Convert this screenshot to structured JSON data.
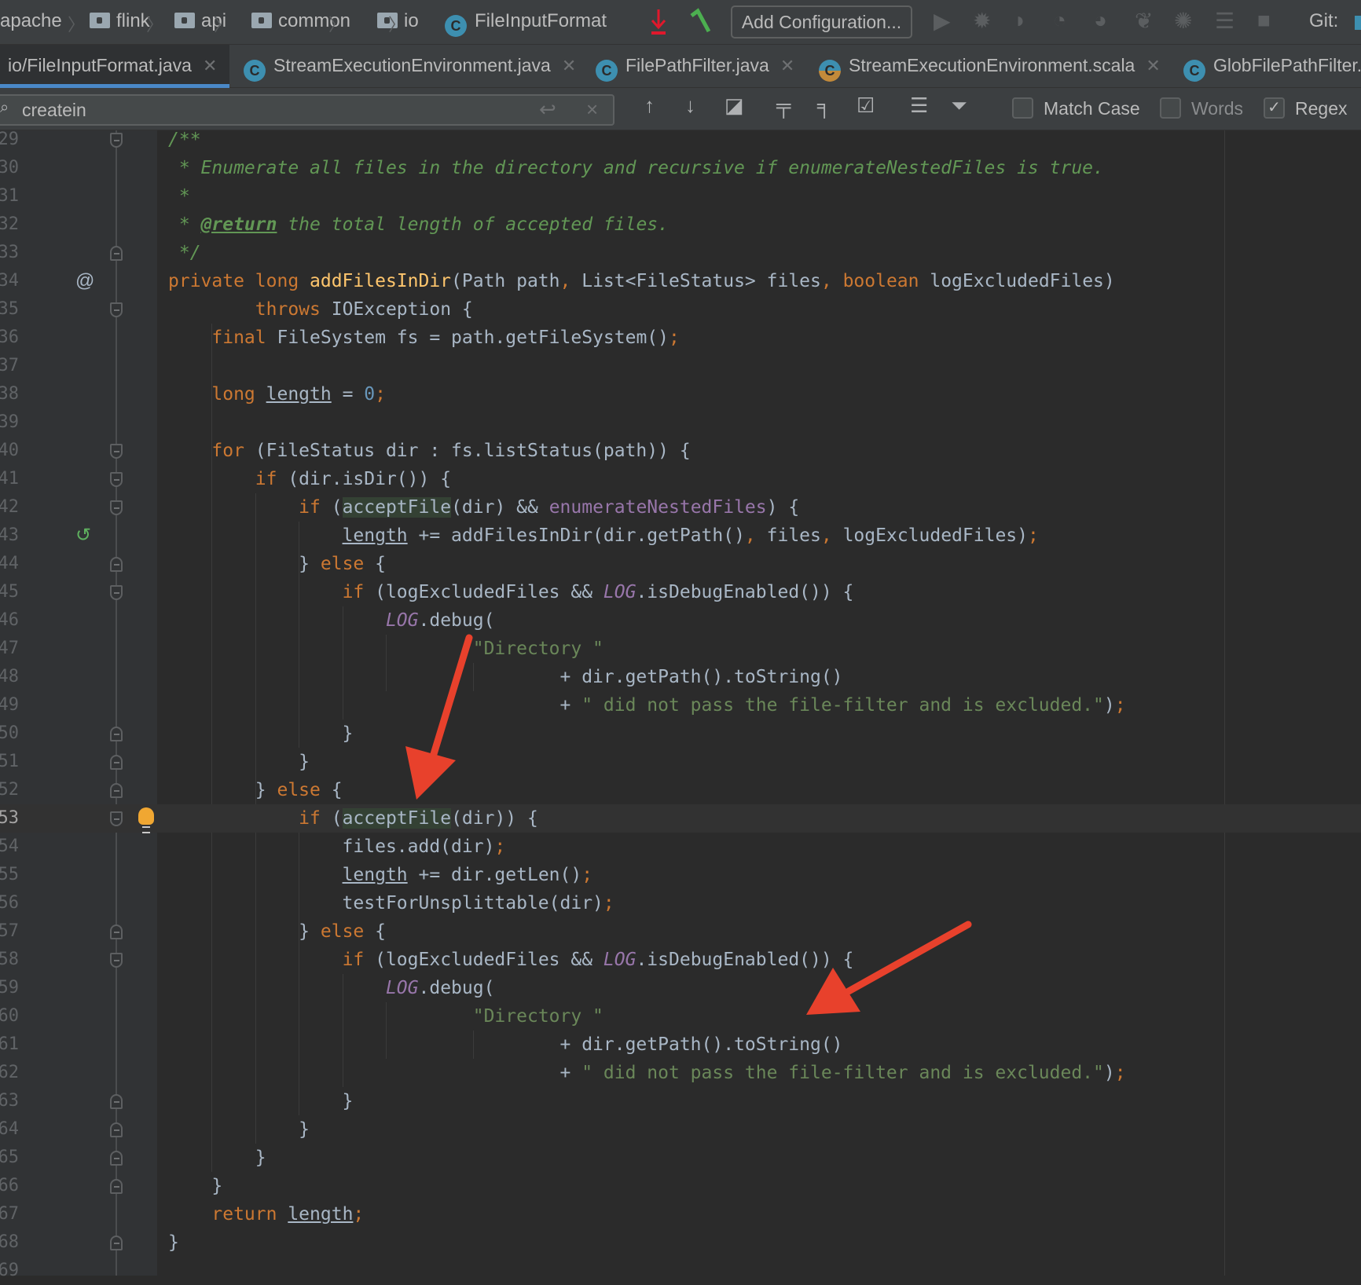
{
  "breadcrumbs": [
    {
      "label": "apache",
      "icon": "folder-icon"
    },
    {
      "label": "flink",
      "icon": "folder-icon"
    },
    {
      "label": "api",
      "icon": "folder-icon"
    },
    {
      "label": "common",
      "icon": "folder-icon"
    },
    {
      "label": "io",
      "icon": "folder-icon"
    },
    {
      "label": "FileInputFormat",
      "icon": "class-icon"
    }
  ],
  "toolbar": {
    "add_configuration": "Add Configuration...",
    "git_label": "Git:",
    "class_glyph": "C"
  },
  "tabs": [
    {
      "label": "io/FileInputFormat.java",
      "active": true
    },
    {
      "label": "StreamExecutionEnvironment.java"
    },
    {
      "label": "FilePathFilter.java"
    },
    {
      "label": "StreamExecutionEnvironment.scala"
    },
    {
      "label": "GlobFilePathFilter.java"
    }
  ],
  "find": {
    "query": "createin",
    "match_case": {
      "label": "Match Case",
      "checked": false
    },
    "words": {
      "label": "Words",
      "checked": false
    },
    "regex": {
      "label": "Regex",
      "checked": true
    }
  },
  "colors": {
    "keyword": "#cc7832",
    "function": "#ffc66d",
    "string": "#6a8759",
    "comment": "#629755",
    "field": "#9876aa",
    "number": "#6897bb",
    "annotation_arrow": "#e8412c",
    "active_tab": "#4a88c7"
  },
  "current_line": "53",
  "lines": [
    {
      "n": "29",
      "fold": "start",
      "t": [
        [
          "cm",
          "/**"
        ]
      ]
    },
    {
      "n": "30",
      "t": [
        [
          "cm",
          " * Enumerate all files in the directory and recursive if enumerateNestedFiles is true."
        ]
      ]
    },
    {
      "n": "31",
      "t": [
        [
          "cm",
          " *"
        ]
      ]
    },
    {
      "n": "32",
      "t": [
        [
          "cm",
          " * "
        ],
        [
          "tag",
          "@return"
        ],
        [
          "cm",
          " the total length of accepted files."
        ]
      ]
    },
    {
      "n": "33",
      "fold": "end",
      "t": [
        [
          "cm",
          " */"
        ]
      ]
    },
    {
      "n": "34",
      "icon": "@",
      "t": [
        [
          "kw",
          "private long "
        ],
        [
          "fn",
          "addFilesInDir"
        ],
        [
          "p",
          "(Path path"
        ],
        [
          "kw",
          ", "
        ],
        [
          "p",
          "List<FileStatus> files"
        ],
        [
          "kw",
          ", "
        ],
        [
          "kw",
          "boolean "
        ],
        [
          "p",
          "logExcludedFiles)"
        ]
      ]
    },
    {
      "n": "35",
      "fold": "start",
      "t": [
        [
          "p",
          "        "
        ],
        [
          "kw",
          "throws "
        ],
        [
          "p",
          "IOException {"
        ]
      ]
    },
    {
      "n": "36",
      "t": [
        [
          "p",
          "    "
        ],
        [
          "kw",
          "final "
        ],
        [
          "p",
          "FileSystem fs = path.getFileSystem()"
        ],
        [
          "kw",
          ";"
        ]
      ]
    },
    {
      "n": "37",
      "t": []
    },
    {
      "n": "38",
      "t": [
        [
          "p",
          "    "
        ],
        [
          "kw",
          "long "
        ],
        [
          "ul",
          "length"
        ],
        [
          "p",
          " = "
        ],
        [
          "num",
          "0"
        ],
        [
          "kw",
          ";"
        ]
      ]
    },
    {
      "n": "39",
      "t": []
    },
    {
      "n": "40",
      "fold": "start",
      "t": [
        [
          "p",
          "    "
        ],
        [
          "kw",
          "for "
        ],
        [
          "p",
          "(FileStatus dir : fs.listStatus(path)) {"
        ]
      ]
    },
    {
      "n": "41",
      "fold": "start",
      "t": [
        [
          "p",
          "        "
        ],
        [
          "kw",
          "if "
        ],
        [
          "p",
          "(dir.isDir()) {"
        ]
      ]
    },
    {
      "n": "42",
      "fold": "start",
      "t": [
        [
          "p",
          "            "
        ],
        [
          "kw",
          "if "
        ],
        [
          "p",
          "("
        ],
        [
          "hl",
          "acceptFile"
        ],
        [
          "p",
          "(dir) && "
        ],
        [
          "field",
          "enumerateNestedFiles"
        ],
        [
          "p",
          ") {"
        ]
      ]
    },
    {
      "n": "43",
      "icon": "↺",
      "t": [
        [
          "p",
          "                "
        ],
        [
          "ul",
          "length"
        ],
        [
          "p",
          " += addFilesInDir(dir.getPath()"
        ],
        [
          "kw",
          ", "
        ],
        [
          "p",
          "files"
        ],
        [
          "kw",
          ", "
        ],
        [
          "p",
          "logExcludedFiles)"
        ],
        [
          "kw",
          ";"
        ]
      ]
    },
    {
      "n": "44",
      "fold": "end",
      "t": [
        [
          "p",
          "            } "
        ],
        [
          "kw",
          "else "
        ],
        [
          "p",
          "{"
        ]
      ]
    },
    {
      "n": "45",
      "fold": "start",
      "t": [
        [
          "p",
          "                "
        ],
        [
          "kw",
          "if "
        ],
        [
          "p",
          "(logExcludedFiles && "
        ],
        [
          "static",
          "LOG"
        ],
        [
          "p",
          ".isDebugEnabled()) {"
        ]
      ]
    },
    {
      "n": "46",
      "t": [
        [
          "p",
          "                    "
        ],
        [
          "static",
          "LOG"
        ],
        [
          "p",
          ".debug("
        ]
      ]
    },
    {
      "n": "47",
      "t": [
        [
          "p",
          "                            "
        ],
        [
          "str",
          "\"Directory \""
        ]
      ]
    },
    {
      "n": "48",
      "t": [
        [
          "p",
          "                                    + dir.getPath().toString()"
        ]
      ]
    },
    {
      "n": "49",
      "t": [
        [
          "p",
          "                                    + "
        ],
        [
          "str",
          "\" did not pass the file-filter and is excluded.\""
        ],
        [
          "p",
          ")"
        ],
        [
          "kw",
          ";"
        ]
      ]
    },
    {
      "n": "50",
      "fold": "end",
      "t": [
        [
          "p",
          "                }"
        ]
      ]
    },
    {
      "n": "51",
      "fold": "end",
      "t": [
        [
          "p",
          "            }"
        ]
      ]
    },
    {
      "n": "52",
      "fold": "end",
      "t": [
        [
          "p",
          "        } "
        ],
        [
          "kw",
          "else "
        ],
        [
          "p",
          "{"
        ]
      ]
    },
    {
      "n": "53",
      "fold": "start",
      "bulb": true,
      "t": [
        [
          "p",
          "            "
        ],
        [
          "kw",
          "if "
        ],
        [
          "p",
          "("
        ],
        [
          "hl",
          "acceptFile"
        ],
        [
          "p",
          "(dir)) {"
        ]
      ]
    },
    {
      "n": "54",
      "t": [
        [
          "p",
          "                files.add(dir)"
        ],
        [
          "kw",
          ";"
        ]
      ]
    },
    {
      "n": "55",
      "t": [
        [
          "p",
          "                "
        ],
        [
          "ul",
          "length"
        ],
        [
          "p",
          " += dir.getLen()"
        ],
        [
          "kw",
          ";"
        ]
      ]
    },
    {
      "n": "56",
      "t": [
        [
          "p",
          "                testForUnsplittable(dir)"
        ],
        [
          "kw",
          ";"
        ]
      ]
    },
    {
      "n": "57",
      "fold": "end",
      "t": [
        [
          "p",
          "            } "
        ],
        [
          "kw",
          "else "
        ],
        [
          "p",
          "{"
        ]
      ]
    },
    {
      "n": "58",
      "fold": "start",
      "t": [
        [
          "p",
          "                "
        ],
        [
          "kw",
          "if "
        ],
        [
          "p",
          "(logExcludedFiles && "
        ],
        [
          "static",
          "LOG"
        ],
        [
          "p",
          ".isDebugEnabled()) {"
        ]
      ]
    },
    {
      "n": "59",
      "t": [
        [
          "p",
          "                    "
        ],
        [
          "static",
          "LOG"
        ],
        [
          "p",
          ".debug("
        ]
      ]
    },
    {
      "n": "60",
      "t": [
        [
          "p",
          "                            "
        ],
        [
          "str",
          "\"Directory \""
        ]
      ]
    },
    {
      "n": "61",
      "t": [
        [
          "p",
          "                                    + dir.getPath().toString()"
        ]
      ]
    },
    {
      "n": "62",
      "t": [
        [
          "p",
          "                                    + "
        ],
        [
          "str",
          "\" did not pass the file-filter and is excluded.\""
        ],
        [
          "p",
          ")"
        ],
        [
          "kw",
          ";"
        ]
      ]
    },
    {
      "n": "63",
      "fold": "end",
      "t": [
        [
          "p",
          "                }"
        ]
      ]
    },
    {
      "n": "64",
      "fold": "end",
      "t": [
        [
          "p",
          "            }"
        ]
      ]
    },
    {
      "n": "65",
      "fold": "end",
      "t": [
        [
          "p",
          "        }"
        ]
      ]
    },
    {
      "n": "66",
      "fold": "end",
      "t": [
        [
          "p",
          "    }"
        ]
      ]
    },
    {
      "n": "67",
      "t": [
        [
          "p",
          "    "
        ],
        [
          "kw",
          "return "
        ],
        [
          "ul",
          "length"
        ],
        [
          "kw",
          ";"
        ]
      ]
    },
    {
      "n": "68",
      "fold": "end",
      "t": [
        [
          "p",
          "}"
        ]
      ]
    },
    {
      "n": "69",
      "t": []
    }
  ]
}
